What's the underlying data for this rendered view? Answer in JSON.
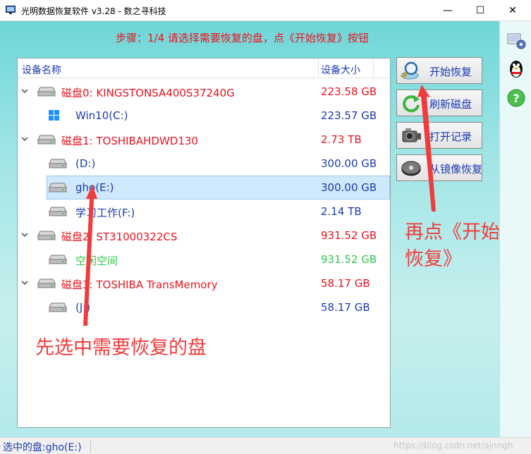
{
  "window": {
    "title": "光明数据恢复软件 v3.28 - 数之寻科技",
    "minimize_glyph": "—",
    "maximize_glyph": "☐",
    "close_glyph": "✕"
  },
  "step_text": "步骤：1/4 请选择需要恢复的盘，点《开始恢复》按钮",
  "tree": {
    "header_name": "设备名称",
    "header_size": "设备大小",
    "rows": [
      {
        "name": "磁盘0: KINGSTONSA400S37240G",
        "size": "223.58 GB"
      },
      {
        "name": "Win10(C:)",
        "size": "223.57 GB"
      },
      {
        "name": "磁盘1: TOSHIBAHDWD130",
        "size": "2.73 TB"
      },
      {
        "name": "(D:)",
        "size": "300.00 GB"
      },
      {
        "name": "gho(E:)",
        "size": "300.00 GB"
      },
      {
        "name": "学习工作(F:)",
        "size": "2.14 TB"
      },
      {
        "name": "磁盘2: ST31000322CS",
        "size": "931.52 GB"
      },
      {
        "name": "空闲空间",
        "size": "931.52 GB"
      },
      {
        "name": "磁盘3: TOSHIBA  TransMemory",
        "size": "58.17 GB"
      },
      {
        "name": "(J:)",
        "size": "58.17 GB"
      }
    ]
  },
  "buttons": {
    "start_recovery": "开始恢复",
    "refresh_disks": "刷新磁盘",
    "open_records": "打开记录",
    "recover_from_image": "从镜像恢复"
  },
  "annotations": {
    "select_disk": "先选中需要恢复的盘",
    "then_click_line1": "再点《开始",
    "then_click_line2": "恢复》"
  },
  "status": {
    "selected_disk": "选中的盘:gho(E:)",
    "watermark": "https://blog.csdn.net/ajnngh"
  },
  "colors": {
    "disk_text": "#e8141e",
    "partition_text": "#1a3bb3",
    "free_space_text": "#2ec84a",
    "annotation": "#f03c3c",
    "background_teal": "#8fdfe0"
  },
  "icons": {
    "side_icon_1": "network-settings-icon",
    "side_icon_2": "qq-penguin-icon",
    "side_icon_3": "help-icon"
  }
}
